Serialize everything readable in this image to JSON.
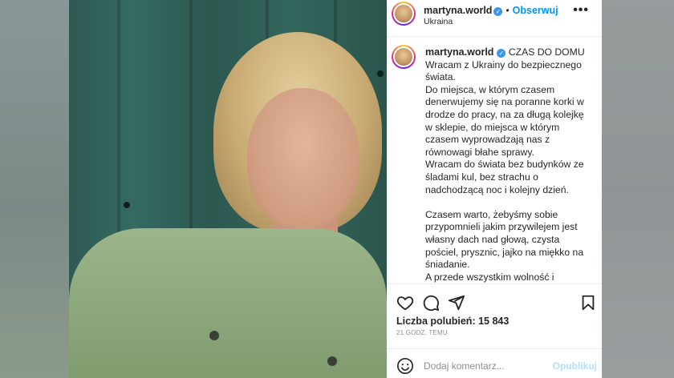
{
  "header": {
    "username": "martyna.world",
    "follow_label": "Obserwuj",
    "location": "Ukraina",
    "more_label": "•••"
  },
  "caption": {
    "username": "martyna.world",
    "title": "CZAS DO DOMU",
    "text": "Wracam z Ukrainy do bezpiecznego świata.\nDo miejsca, w którym czasem denerwujemy się na poranne korki w drodze do pracy, na za długą kolejkę w sklepie, do miejsca w którym czasem wyprowadzają nas z równowagi błahe sprawy.\nWracam do świata bez budynków ze śladami kul, bez strachu o nadchodzącą noc i kolejny dzień.\n\nCzasem warto, żebyśmy sobie przypomnieli jakim przywilejem jest własny dach nad głową, czysta pościel, prysznic, jajko na miękko na śniadanie.\nA przede wszystkim wolność i bezpieczeństwo."
  },
  "actions": {
    "likes": "Liczba polubień: 15 843",
    "timestamp": "21 GODZ. TEMU"
  },
  "comment": {
    "placeholder": "Dodaj komentarz...",
    "post_label": "Opublikuj"
  },
  "icons": {
    "verified": "verified-badge-icon",
    "like": "heart-icon",
    "comment": "comment-bubble-icon",
    "share": "paper-plane-icon",
    "save": "bookmark-icon",
    "emoji": "smiley-icon"
  },
  "colors": {
    "link_blue": "#0095f6",
    "verified_blue": "#3897f0",
    "post_disabled": "#b2dffc",
    "muted": "#8e8e8e"
  }
}
